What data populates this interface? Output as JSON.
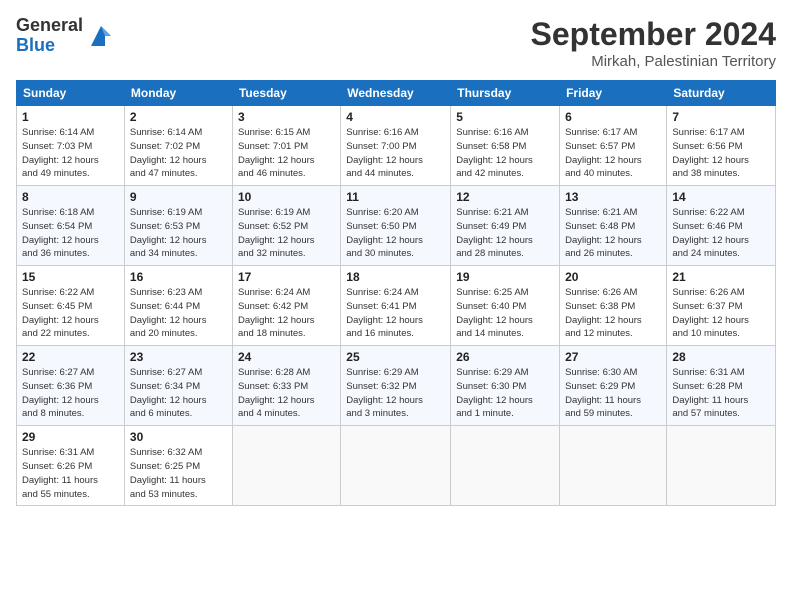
{
  "logo": {
    "general": "General",
    "blue": "Blue"
  },
  "header": {
    "title": "September 2024",
    "subtitle": "Mirkah, Palestinian Territory"
  },
  "days_of_week": [
    "Sunday",
    "Monday",
    "Tuesday",
    "Wednesday",
    "Thursday",
    "Friday",
    "Saturday"
  ],
  "weeks": [
    [
      {
        "day": "1",
        "info": "Sunrise: 6:14 AM\nSunset: 7:03 PM\nDaylight: 12 hours\nand 49 minutes."
      },
      {
        "day": "2",
        "info": "Sunrise: 6:14 AM\nSunset: 7:02 PM\nDaylight: 12 hours\nand 47 minutes."
      },
      {
        "day": "3",
        "info": "Sunrise: 6:15 AM\nSunset: 7:01 PM\nDaylight: 12 hours\nand 46 minutes."
      },
      {
        "day": "4",
        "info": "Sunrise: 6:16 AM\nSunset: 7:00 PM\nDaylight: 12 hours\nand 44 minutes."
      },
      {
        "day": "5",
        "info": "Sunrise: 6:16 AM\nSunset: 6:58 PM\nDaylight: 12 hours\nand 42 minutes."
      },
      {
        "day": "6",
        "info": "Sunrise: 6:17 AM\nSunset: 6:57 PM\nDaylight: 12 hours\nand 40 minutes."
      },
      {
        "day": "7",
        "info": "Sunrise: 6:17 AM\nSunset: 6:56 PM\nDaylight: 12 hours\nand 38 minutes."
      }
    ],
    [
      {
        "day": "8",
        "info": "Sunrise: 6:18 AM\nSunset: 6:54 PM\nDaylight: 12 hours\nand 36 minutes."
      },
      {
        "day": "9",
        "info": "Sunrise: 6:19 AM\nSunset: 6:53 PM\nDaylight: 12 hours\nand 34 minutes."
      },
      {
        "day": "10",
        "info": "Sunrise: 6:19 AM\nSunset: 6:52 PM\nDaylight: 12 hours\nand 32 minutes."
      },
      {
        "day": "11",
        "info": "Sunrise: 6:20 AM\nSunset: 6:50 PM\nDaylight: 12 hours\nand 30 minutes."
      },
      {
        "day": "12",
        "info": "Sunrise: 6:21 AM\nSunset: 6:49 PM\nDaylight: 12 hours\nand 28 minutes."
      },
      {
        "day": "13",
        "info": "Sunrise: 6:21 AM\nSunset: 6:48 PM\nDaylight: 12 hours\nand 26 minutes."
      },
      {
        "day": "14",
        "info": "Sunrise: 6:22 AM\nSunset: 6:46 PM\nDaylight: 12 hours\nand 24 minutes."
      }
    ],
    [
      {
        "day": "15",
        "info": "Sunrise: 6:22 AM\nSunset: 6:45 PM\nDaylight: 12 hours\nand 22 minutes."
      },
      {
        "day": "16",
        "info": "Sunrise: 6:23 AM\nSunset: 6:44 PM\nDaylight: 12 hours\nand 20 minutes."
      },
      {
        "day": "17",
        "info": "Sunrise: 6:24 AM\nSunset: 6:42 PM\nDaylight: 12 hours\nand 18 minutes."
      },
      {
        "day": "18",
        "info": "Sunrise: 6:24 AM\nSunset: 6:41 PM\nDaylight: 12 hours\nand 16 minutes."
      },
      {
        "day": "19",
        "info": "Sunrise: 6:25 AM\nSunset: 6:40 PM\nDaylight: 12 hours\nand 14 minutes."
      },
      {
        "day": "20",
        "info": "Sunrise: 6:26 AM\nSunset: 6:38 PM\nDaylight: 12 hours\nand 12 minutes."
      },
      {
        "day": "21",
        "info": "Sunrise: 6:26 AM\nSunset: 6:37 PM\nDaylight: 12 hours\nand 10 minutes."
      }
    ],
    [
      {
        "day": "22",
        "info": "Sunrise: 6:27 AM\nSunset: 6:36 PM\nDaylight: 12 hours\nand 8 minutes."
      },
      {
        "day": "23",
        "info": "Sunrise: 6:27 AM\nSunset: 6:34 PM\nDaylight: 12 hours\nand 6 minutes."
      },
      {
        "day": "24",
        "info": "Sunrise: 6:28 AM\nSunset: 6:33 PM\nDaylight: 12 hours\nand 4 minutes."
      },
      {
        "day": "25",
        "info": "Sunrise: 6:29 AM\nSunset: 6:32 PM\nDaylight: 12 hours\nand 3 minutes."
      },
      {
        "day": "26",
        "info": "Sunrise: 6:29 AM\nSunset: 6:30 PM\nDaylight: 12 hours\nand 1 minute."
      },
      {
        "day": "27",
        "info": "Sunrise: 6:30 AM\nSunset: 6:29 PM\nDaylight: 11 hours\nand 59 minutes."
      },
      {
        "day": "28",
        "info": "Sunrise: 6:31 AM\nSunset: 6:28 PM\nDaylight: 11 hours\nand 57 minutes."
      }
    ],
    [
      {
        "day": "29",
        "info": "Sunrise: 6:31 AM\nSunset: 6:26 PM\nDaylight: 11 hours\nand 55 minutes."
      },
      {
        "day": "30",
        "info": "Sunrise: 6:32 AM\nSunset: 6:25 PM\nDaylight: 11 hours\nand 53 minutes."
      },
      {
        "day": "",
        "info": ""
      },
      {
        "day": "",
        "info": ""
      },
      {
        "day": "",
        "info": ""
      },
      {
        "day": "",
        "info": ""
      },
      {
        "day": "",
        "info": ""
      }
    ]
  ]
}
